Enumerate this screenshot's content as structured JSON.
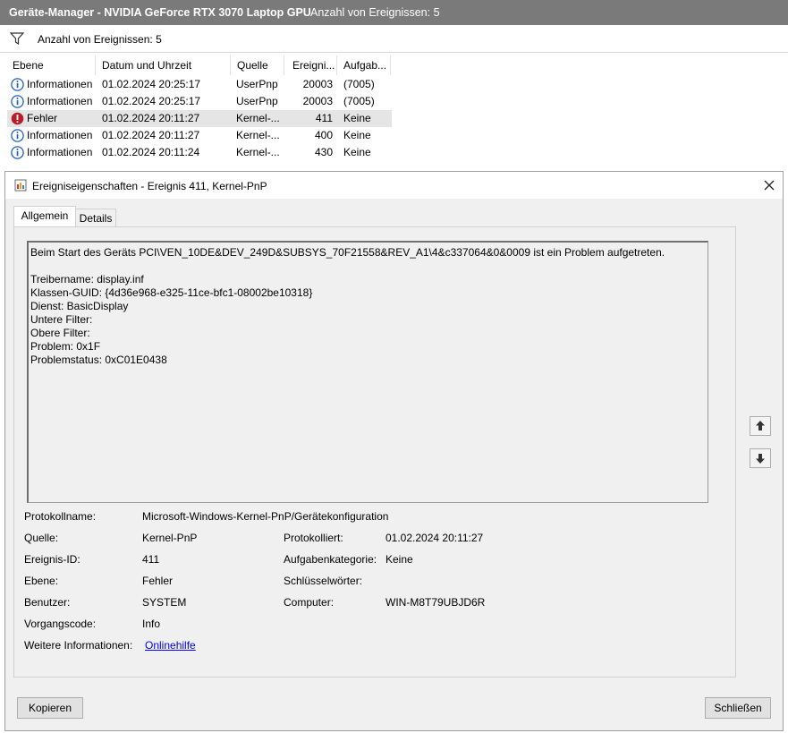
{
  "window": {
    "title": "Geräte-Manager - NVIDIA GeForce RTX 3070 Laptop GPU",
    "event_count": "Anzahl von Ereignissen: 5"
  },
  "filter": {
    "icon": "filter-icon",
    "text": "Anzahl von Ereignissen: 5"
  },
  "list": {
    "headers": [
      "Ebene",
      "Datum und Uhrzeit",
      "Quelle",
      "Ereigni...",
      "Aufgab..."
    ],
    "rows": [
      {
        "level": "Informationen",
        "date": "01.02.2024 20:25:17",
        "source": "UserPnp",
        "id": "20003",
        "task": "(7005)",
        "icon": "info-icon"
      },
      {
        "level": "Informationen",
        "date": "01.02.2024 20:25:17",
        "source": "UserPnp",
        "id": "20003",
        "task": "(7005)",
        "icon": "info-icon"
      },
      {
        "level": "Fehler",
        "date": "01.02.2024 20:11:27",
        "source": "Kernel-...",
        "id": "411",
        "task": "Keine",
        "icon": "error-icon"
      },
      {
        "level": "Informationen",
        "date": "01.02.2024 20:11:27",
        "source": "Kernel-...",
        "id": "400",
        "task": "Keine",
        "icon": "info-icon"
      },
      {
        "level": "Informationen",
        "date": "01.02.2024 20:11:24",
        "source": "Kernel-...",
        "id": "430",
        "task": "Keine",
        "icon": "info-icon"
      }
    ]
  },
  "dialog": {
    "title": "Ereigniseigenschaften - Ereignis 411, Kernel-PnP",
    "tabs": [
      "Allgemein",
      "Details"
    ],
    "description": {
      "line1": "Beim Start des Geräts PCI\\VEN_10DE&DEV_249D&SUBSYS_70F21558&REV_A1\\4&c337064&0&0009 ist ein Problem aufgetreten.",
      "line2": "Treibername: display.inf",
      "line3": "Klassen-GUID: {4d36e968-e325-11ce-bfc1-08002be10318}",
      "line4": "Dienst: BasicDisplay",
      "line5": "Untere Filter:",
      "line6": "Obere Filter:",
      "line7": "Problem: 0x1F",
      "line8": "Problemstatus: 0xC01E0438"
    },
    "fields": {
      "protokollname_label": "Protokollname:",
      "protokollname_value": "Microsoft-Windows-Kernel-PnP/Gerätekonfiguration",
      "quelle_label": "Quelle:",
      "quelle_value": "Kernel-PnP",
      "protokolliert_label": "Protokolliert:",
      "protokolliert_value": "01.02.2024 20:11:27",
      "ereignis_id_label": "Ereignis-ID:",
      "ereignis_id_value": "411",
      "aufgabenkategorie_label": "Aufgabenkategorie:",
      "aufgabenkategorie_value": "Keine",
      "ebene_label": "Ebene:",
      "ebene_value": "Fehler",
      "schluesselwoerter_label": "Schlüsselwörter:",
      "schluesselwoerter_value": "",
      "benutzer_label": "Benutzer:",
      "benutzer_value": "SYSTEM",
      "computer_label": "Computer:",
      "computer_value": "WIN-M8T79UBJD6R",
      "vorgangscode_label": "Vorgangscode:",
      "vorgangscode_value": "Info",
      "weitere_label": "Weitere Informationen:",
      "weitere_link": "Onlinehilfe"
    },
    "buttons": {
      "copy": "Kopieren",
      "close": "Schließen"
    }
  },
  "colors": {
    "titlebar": "#7a7a7a",
    "selected_row": "#e5e5e5",
    "dialog_bg": "#f0f0f0",
    "link": "#0000ee",
    "info_icon": "#1f5fbf",
    "error_icon": "#b81d2a"
  }
}
